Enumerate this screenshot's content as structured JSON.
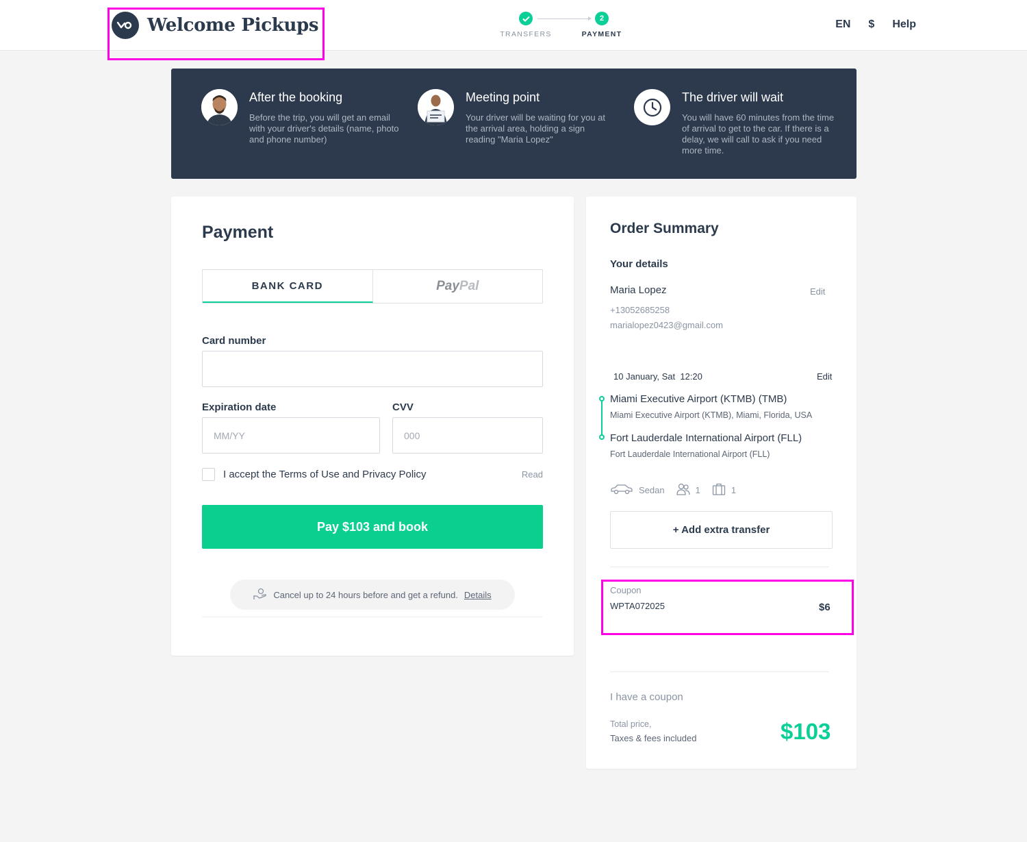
{
  "header": {
    "brand": "Welcome Pickups",
    "steps": [
      {
        "label": "TRANSFERS",
        "state": "done"
      },
      {
        "label": "PAYMENT",
        "number": "2",
        "state": "active"
      }
    ],
    "language": "EN",
    "currency": "$",
    "help": "Help"
  },
  "banner": {
    "features": [
      {
        "title": "After the booking",
        "text": "Before the trip, you will get an email with your driver's details (name, photo and phone number)",
        "icon": "driver-avatar"
      },
      {
        "title": "Meeting point",
        "text": "Your driver will be waiting for you at the arrival area, holding a sign reading \"Maria Lopez\"",
        "icon": "driver-with-sign-avatar"
      },
      {
        "title": "The driver will wait",
        "text": "You will have 60 minutes from the time of arrival to get to the car. If there is a delay, we will call to ask if you need more time.",
        "icon": "clock-icon"
      }
    ]
  },
  "payment": {
    "title": "Payment",
    "tabs": {
      "bank_card": "BANK CARD",
      "paypal_a": "Pay",
      "paypal_b": "Pal"
    },
    "card_number_label": "Card number",
    "expiration_label": "Expiration date",
    "expiration_placeholder": "MM/YY",
    "cvv_label": "CVV",
    "cvv_placeholder": "000",
    "terms": "I accept the Terms of Use and Privacy Policy",
    "read": "Read",
    "pay_button": "Pay $103 and book",
    "refund_text": "Cancel up to 24 hours before and get a refund.",
    "refund_link": "Details"
  },
  "summary": {
    "title": "Order Summary",
    "your_details": "Your details",
    "name": "Maria Lopez",
    "phone": "+13052685258",
    "email": "marialopez0423@gmail.com",
    "edit": "Edit",
    "date": "10 January, Sat  12:20",
    "from": {
      "name": "Miami Executive Airport (KTMB) (TMB)",
      "address": "Miami Executive Airport (KTMB), Miami, Florida, USA"
    },
    "to": {
      "name": "Fort Lauderdale International Airport (FLL)",
      "address": "Fort Lauderdale International Airport (FLL)"
    },
    "vehicle": "Sedan",
    "passengers": "1",
    "luggage": "1",
    "add_transfer": "+ Add extra transfer",
    "coupon_label": "Coupon",
    "coupon_code": "WPTA072025",
    "coupon_amount": "$6",
    "have_coupon": "I have a coupon",
    "total_label": "Total price,",
    "total_sub": "Taxes & fees included",
    "total": "$103"
  },
  "colors": {
    "accent": "#0acf97",
    "dark": "#2d3a4d",
    "highlight": "#ff00e6"
  }
}
